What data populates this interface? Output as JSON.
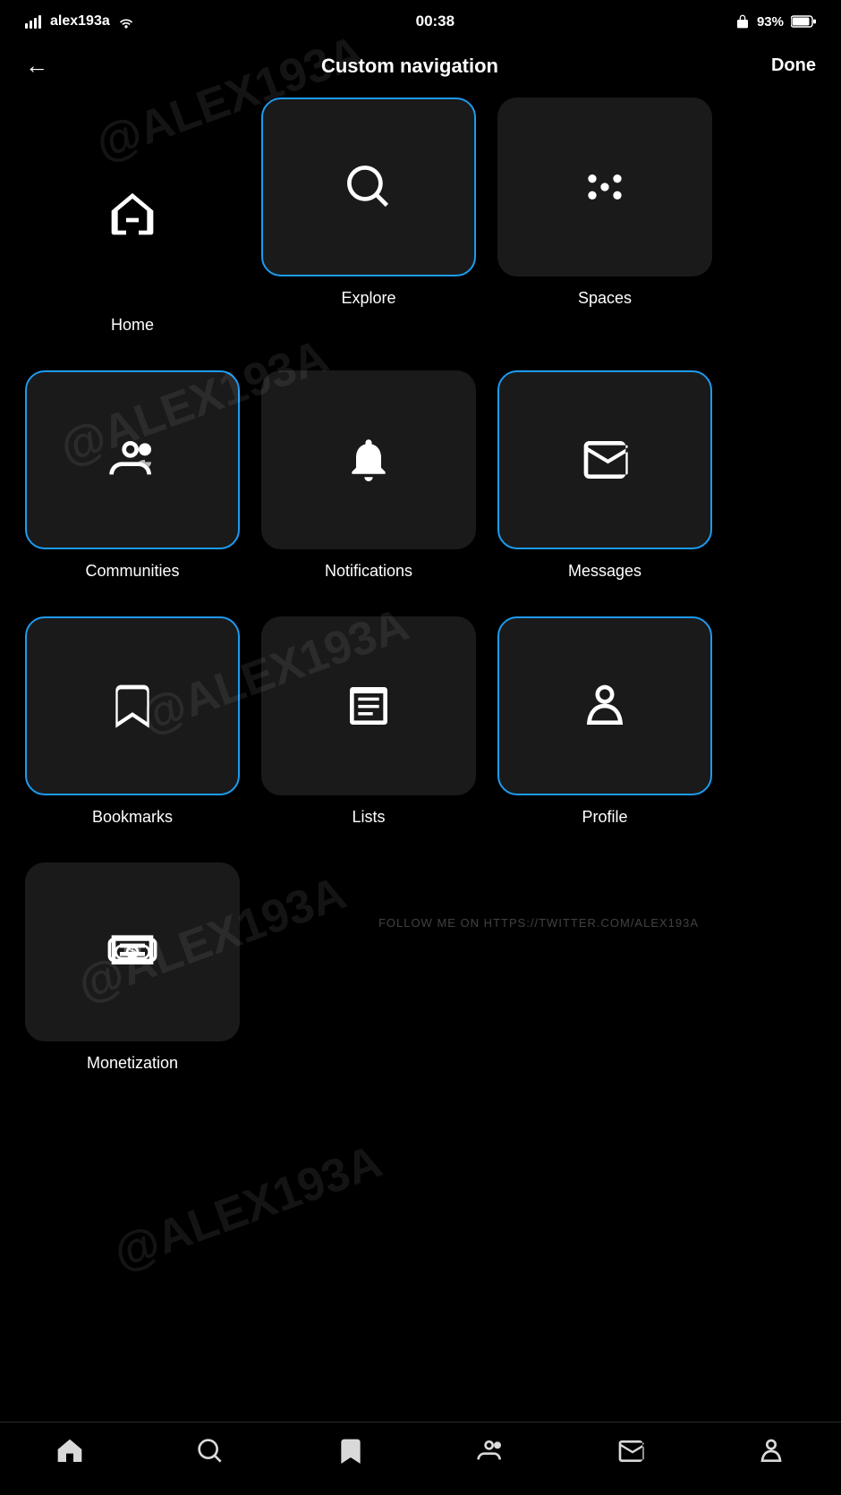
{
  "statusBar": {
    "carrier": "alex193a",
    "wifi": "wifi",
    "time": "00:38",
    "lock": "🔒",
    "battery": "93%"
  },
  "header": {
    "back": "←",
    "title": "Custom navigation",
    "done": "Done"
  },
  "watermark": "@ALEX193A",
  "items": [
    {
      "id": "home",
      "label": "Home",
      "icon": "home",
      "selected": false,
      "noTile": true
    },
    {
      "id": "explore",
      "label": "Explore",
      "icon": "search",
      "selected": true,
      "noTile": false
    },
    {
      "id": "spaces",
      "label": "Spaces",
      "icon": "spaces",
      "selected": false,
      "noTile": false
    },
    {
      "id": "communities",
      "label": "Communities",
      "icon": "communities",
      "selected": true,
      "noTile": false
    },
    {
      "id": "notifications",
      "label": "Notifications",
      "icon": "bell",
      "selected": false,
      "noTile": false
    },
    {
      "id": "messages",
      "label": "Messages",
      "icon": "mail",
      "selected": true,
      "noTile": false
    },
    {
      "id": "bookmarks",
      "label": "Bookmarks",
      "icon": "bookmark",
      "selected": true,
      "noTile": false
    },
    {
      "id": "lists",
      "label": "Lists",
      "icon": "list",
      "selected": false,
      "noTile": false
    },
    {
      "id": "profile",
      "label": "Profile",
      "icon": "person",
      "selected": true,
      "noTile": false
    },
    {
      "id": "monetization",
      "label": "Monetization",
      "icon": "money",
      "selected": false,
      "noTile": false
    }
  ],
  "followText": "FOLLOW ME ON HTTPS://TWITTER.COM/ALEX193A",
  "tabBar": [
    {
      "id": "home",
      "icon": "home"
    },
    {
      "id": "search",
      "icon": "search"
    },
    {
      "id": "bookmark",
      "icon": "bookmark"
    },
    {
      "id": "communities",
      "icon": "communities"
    },
    {
      "id": "mail",
      "icon": "mail"
    },
    {
      "id": "person",
      "icon": "person"
    }
  ]
}
